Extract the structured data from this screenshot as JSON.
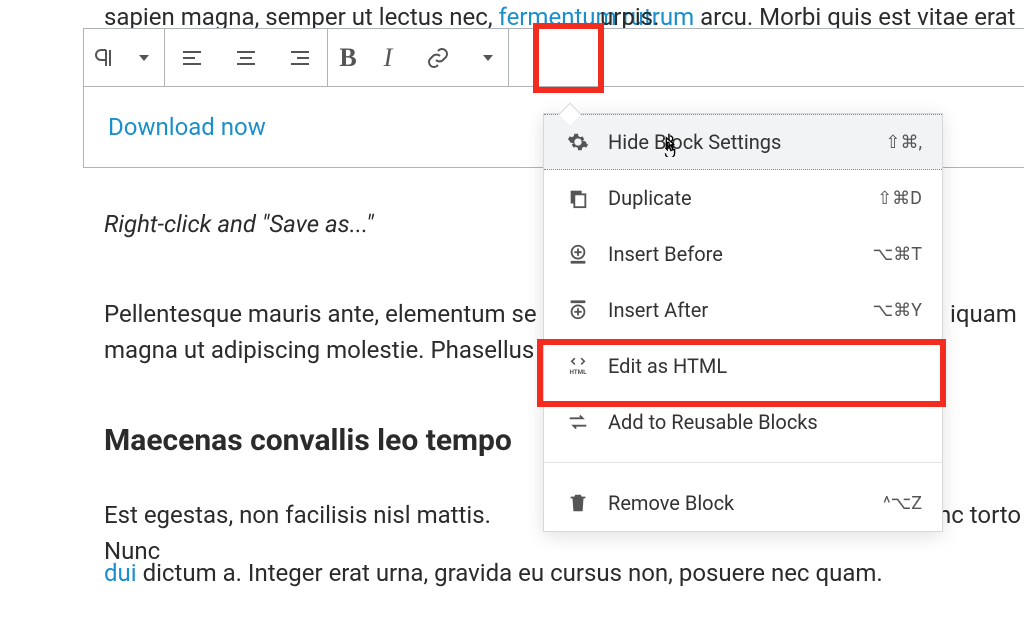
{
  "bg": {
    "line0_pre": "sapien magna, semper ut lectus nec, ",
    "line0_link": "fermentum rutrum",
    "line0_post": " arcu. Morbi quis est vitae erat a",
    "line0_tail": "urpis.",
    "hint": "Right-click and \"Save as...\"",
    "para2a": "Pellentesque mauris ante, elementum se",
    "para2a_tail": "iquam",
    "para2b": "magna ut adipiscing molestie. Phasellus",
    "heading": "Maecenas convallis leo tempo",
    "para3a_pre": "Est egestas, non facilisis nisl mattis. Nunc",
    "para3a_tail": "nc torto",
    "para3b_link": "dui",
    "para3b_rest": " dictum a. Integer erat urna, gravida eu cursus non, posuere nec quam."
  },
  "toolbar": {
    "link_text": "Download now"
  },
  "menu": {
    "hide": {
      "label": "Hide Block Settings",
      "shortcut": "⇧⌘,"
    },
    "duplicate": {
      "label": "Duplicate",
      "shortcut": "⇧⌘D"
    },
    "insert_before": {
      "label": "Insert Before",
      "shortcut": "⌥⌘T"
    },
    "insert_after": {
      "label": "Insert After",
      "shortcut": "⌥⌘Y"
    },
    "edit_html": {
      "label": "Edit as HTML"
    },
    "reusable": {
      "label": "Add to Reusable Blocks"
    },
    "remove": {
      "label": "Remove Block",
      "shortcut": "^⌥Z"
    }
  }
}
